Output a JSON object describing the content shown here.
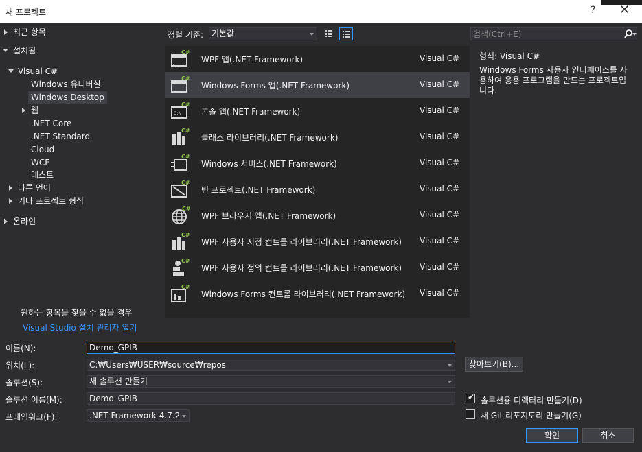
{
  "window": {
    "title": "새 프로젝트",
    "help_label": "?",
    "close_label": "✕"
  },
  "nav": {
    "recent": "최근 항목",
    "installed": "설치됨",
    "visual_csharp": "Visual C#",
    "windows_universal": "Windows 유니버설",
    "windows_desktop": "Windows Desktop",
    "web": "웹",
    "net_core": ".NET Core",
    "net_standard": ".NET Standard",
    "cloud": "Cloud",
    "wcf": "WCF",
    "test": "테스트",
    "other_languages": "다른 언어",
    "other_project_types": "기타 프로젝트 형식",
    "online": "온라인",
    "help_text": "원하는 항목을 찾을 수 없을 경우",
    "help_link": "Visual Studio 설치 관리자 열기"
  },
  "toolbar": {
    "sort_label": "정렬 기준:",
    "sort_value": "기본값"
  },
  "templates": [
    {
      "name": "WPF 앱(.NET Framework)",
      "lang": "Visual C#",
      "icon": "wpf-app-icon"
    },
    {
      "name": "Windows Forms 앱(.NET Framework)",
      "lang": "Visual C#",
      "icon": "windows-forms-app-icon"
    },
    {
      "name": "콘솔 앱(.NET Framework)",
      "lang": "Visual C#",
      "icon": "console-app-icon"
    },
    {
      "name": "클래스 라이브러리(.NET Framework)",
      "lang": "Visual C#",
      "icon": "class-library-icon"
    },
    {
      "name": "Windows 서비스(.NET Framework)",
      "lang": "Visual C#",
      "icon": "windows-service-icon"
    },
    {
      "name": "빈 프로젝트(.NET Framework)",
      "lang": "Visual C#",
      "icon": "empty-project-icon"
    },
    {
      "name": "WPF 브라우저 앱(.NET Framework)",
      "lang": "Visual C#",
      "icon": "wpf-browser-app-icon"
    },
    {
      "name": "WPF 사용자 지정 컨트롤 라이브러리(.NET Framework)",
      "lang": "Visual C#",
      "icon": "wpf-custom-control-library-icon"
    },
    {
      "name": "WPF 사용자 정의 컨트롤 라이브러리(.NET Framework)",
      "lang": "Visual C#",
      "icon": "wpf-user-control-library-icon"
    },
    {
      "name": "Windows Forms 컨트롤 라이브러리(.NET Framework)",
      "lang": "Visual C#",
      "icon": "windows-forms-control-library-icon"
    }
  ],
  "search": {
    "placeholder": "검색(Ctrl+E)"
  },
  "detail": {
    "kind": "형식:  Visual C#",
    "description": "Windows Forms 사용자 인터페이스를 사용하여 응용 프로그램을 만드는 프로젝트입니다."
  },
  "form": {
    "name_label": "이름(N):",
    "name_value": "Demo_GPIB",
    "location_label": "위치(L):",
    "location_value": "C:₩Users₩USER₩source₩repos",
    "solution_label": "솔루션(S):",
    "solution_value": "새 솔루션 만들기",
    "solution_name_label": "솔루션 이름(M):",
    "solution_name_value": "Demo_GPIB",
    "framework_label": "프레임워크(F):",
    "framework_value": ".NET Framework 4.7.2",
    "browse_label": "찾아보기(B)...",
    "create_dir_label": "솔루션용 디렉터리 만들기(D)",
    "create_dir_checked": true,
    "git_label": "새 Git 리포지토리 만들기(G)",
    "git_checked": false,
    "ok_label": "확인",
    "cancel_label": "취소"
  },
  "colors": {
    "accent": "#3794ff",
    "background": "#2d2d30",
    "list_bg": "#252526",
    "selected_bg": "#3f3f46",
    "csharp_green": "#8bc34a"
  }
}
